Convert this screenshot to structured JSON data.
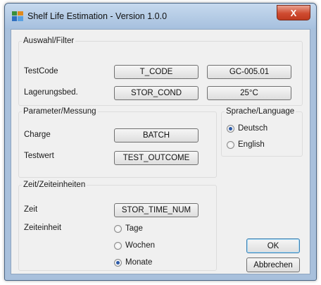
{
  "window": {
    "title": "Shelf Life Estimation - Version 1.0.0",
    "close_glyph": "X"
  },
  "filter": {
    "title": "Auswahl/Filter",
    "testcode_label": "TestCode",
    "testcode_field": "T_CODE",
    "testcode_value": "GC-005.01",
    "storage_label": "Lagerungsbed.",
    "storage_field": "STOR_COND",
    "storage_value": "25°C"
  },
  "params": {
    "title": "Parameter/Messung",
    "batch_label": "Charge",
    "batch_field": "BATCH",
    "result_label": "Testwert",
    "result_field": "TEST_OUTCOME"
  },
  "language": {
    "title": "Sprache/Language",
    "options": [
      {
        "label": "Deutsch",
        "checked": true
      },
      {
        "label": "English",
        "checked": false
      }
    ]
  },
  "time": {
    "title": "Zeit/Zeiteinheiten",
    "time_label": "Zeit",
    "time_field": "STOR_TIME_NUM",
    "unit_label": "Zeiteinheit",
    "units": [
      {
        "label": "Tage",
        "checked": false
      },
      {
        "label": "Wochen",
        "checked": false
      },
      {
        "label": "Monate",
        "checked": true
      }
    ]
  },
  "actions": {
    "ok_label": "OK",
    "cancel_label": "Abbrechen"
  }
}
